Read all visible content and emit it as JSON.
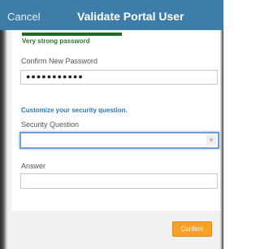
{
  "header": {
    "cancel_label": "Cancel",
    "title": "Validate Portal User"
  },
  "password_strength": {
    "text": "Very strong password",
    "color": "#1e6b27"
  },
  "confirm_password": {
    "label": "Confirm New Password",
    "value": "●●●●●●●●●●●"
  },
  "security": {
    "hint": "Customize your security question.",
    "question_label": "Security Question",
    "question_value": "",
    "answer_label": "Answer",
    "answer_value": ""
  },
  "footer": {
    "confirm_label": "Confirm"
  },
  "colors": {
    "header": "#3d7da7",
    "accent": "#f5a12a",
    "link": "#2a78b3"
  }
}
